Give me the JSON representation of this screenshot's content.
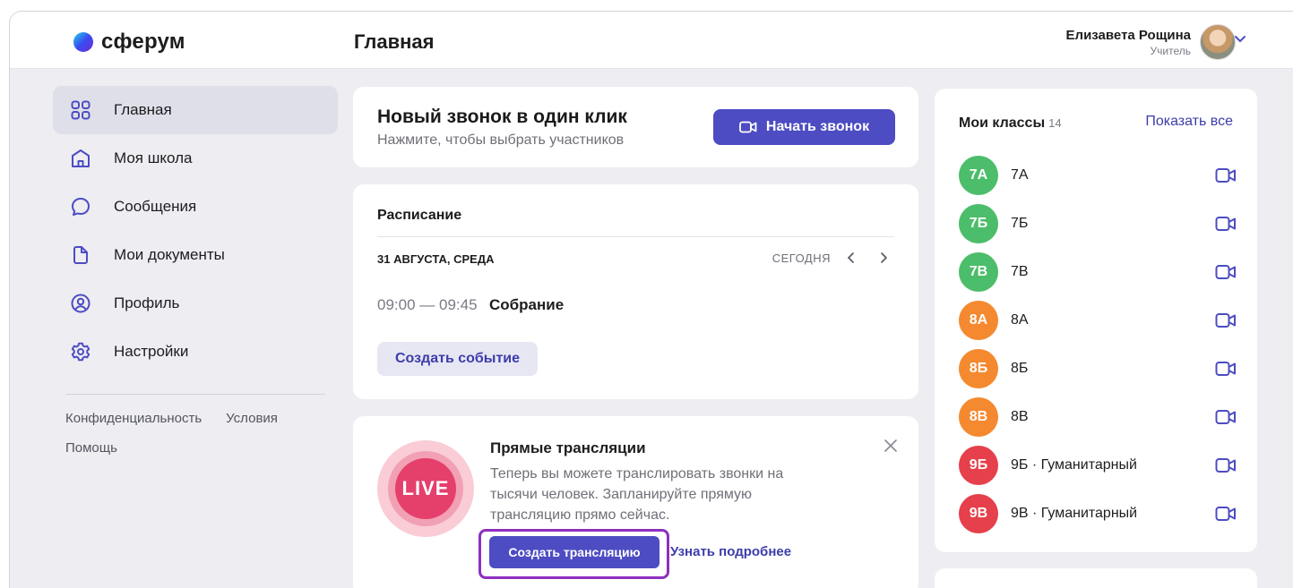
{
  "brand": {
    "name": "сферум"
  },
  "header": {
    "title": "Главная",
    "user_name": "Елизавета Рощина",
    "user_role": "Учитель"
  },
  "sidebar": {
    "items": [
      {
        "label": "Главная",
        "icon": "grid-icon",
        "active": true
      },
      {
        "label": "Моя школа",
        "icon": "school-icon",
        "active": false
      },
      {
        "label": "Сообщения",
        "icon": "chat-bubble-icon",
        "active": false
      },
      {
        "label": "Мои документы",
        "icon": "document-icon",
        "active": false
      },
      {
        "label": "Профиль",
        "icon": "profile-icon",
        "active": false
      },
      {
        "label": "Настройки",
        "icon": "gear-icon",
        "active": false
      }
    ],
    "footer_links": [
      "Конфиденциальность",
      "Условия",
      "Помощь"
    ]
  },
  "call_card": {
    "title": "Новый звонок в один клик",
    "subtitle": "Нажмите, чтобы выбрать участников",
    "button_label": "Начать звонок"
  },
  "schedule": {
    "title": "Расписание",
    "date": "31 АВГУСТА, СРЕДА",
    "today_label": "СЕГОДНЯ",
    "event_time": "09:00 — 09:45",
    "event_name": "Собрание",
    "create_button": "Создать событие"
  },
  "live": {
    "badge": "LIVE",
    "title": "Прямые трансляции",
    "text": "Теперь вы можете транслировать звонки на тысячи человек. Запланируйте прямую трансляцию прямо сейчас.",
    "create_button": "Создать трансляцию",
    "more_link": "Узнать подробнее"
  },
  "classes": {
    "title": "Мои классы",
    "count": "14",
    "show_all": "Показать все",
    "items": [
      {
        "badge": "7А",
        "name": "7А",
        "color": "#4cbd6a"
      },
      {
        "badge": "7Б",
        "name": "7Б",
        "color": "#4cbd6a"
      },
      {
        "badge": "7В",
        "name": "7В",
        "color": "#4cbd6a"
      },
      {
        "badge": "8А",
        "name": "8А",
        "color": "#f4892f"
      },
      {
        "badge": "8Б",
        "name": "8Б",
        "color": "#f4892f"
      },
      {
        "badge": "8В",
        "name": "8В",
        "color": "#f4892f"
      },
      {
        "badge": "9Б",
        "name": "9Б · Гуманитарный",
        "color": "#e5404b"
      },
      {
        "badge": "9В",
        "name": "9В · Гуманитарный",
        "color": "#e5404b"
      }
    ]
  },
  "colors": {
    "accent": "#4d4cc2",
    "highlight": "#8e2fc0",
    "live": "#e53f6c"
  }
}
